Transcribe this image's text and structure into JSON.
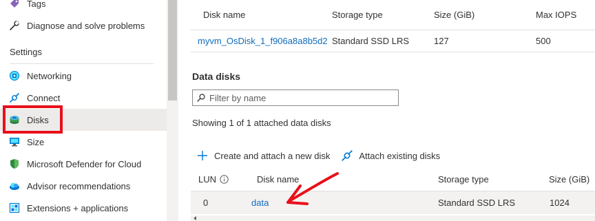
{
  "nav": {
    "items_top": [
      {
        "label": "Tags",
        "icon": "tag-icon"
      },
      {
        "label": "Diagnose and solve problems",
        "icon": "wrench-icon"
      }
    ],
    "section": "Settings",
    "items": [
      {
        "label": "Networking",
        "icon": "networking-icon"
      },
      {
        "label": "Connect",
        "icon": "connect-plug-icon"
      },
      {
        "label": "Disks",
        "icon": "disks-icon",
        "selected": true
      },
      {
        "label": "Size",
        "icon": "monitor-size-icon"
      },
      {
        "label": "Microsoft Defender for Cloud",
        "icon": "shield-icon"
      },
      {
        "label": "Advisor recommendations",
        "icon": "cloud-advisor-icon"
      },
      {
        "label": "Extensions + applications",
        "icon": "extensions-icon"
      }
    ]
  },
  "os_disk": {
    "columns": [
      "Disk name",
      "Storage type",
      "Size (GiB)",
      "Max IOPS"
    ],
    "row": {
      "disk_name": "myvm_OsDisk_1_f906a8a8b5d2",
      "storage_type": "Standard SSD LRS",
      "size": "127",
      "max_iops": "500"
    }
  },
  "data_disks": {
    "title": "Data disks",
    "filter_placeholder": "Filter by name",
    "showing_text": "Showing 1 of 1 attached data disks",
    "toolbar": {
      "create_attach": "Create and attach a new disk",
      "attach_existing": "Attach existing disks"
    },
    "columns": [
      "LUN",
      "Disk name",
      "Storage type",
      "Size (GiB)"
    ],
    "rows": [
      {
        "lun": "0",
        "disk_name": "data",
        "storage_type": "Standard SSD LRS",
        "size": "1024"
      }
    ]
  },
  "colors": {
    "accent": "#0f6cbd",
    "annotation_red": "#e8101a",
    "selected_bg": "#edebe9"
  }
}
